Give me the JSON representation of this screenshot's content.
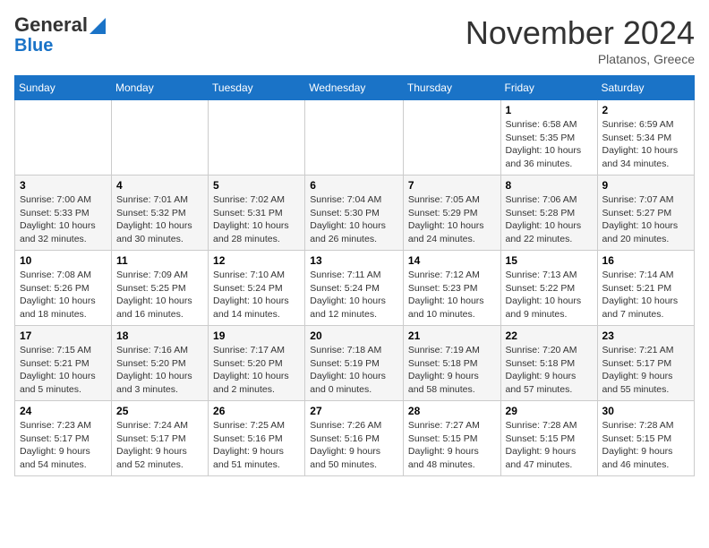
{
  "header": {
    "logo_line1": "General",
    "logo_line2": "Blue",
    "month": "November 2024",
    "location": "Platanos, Greece"
  },
  "days_of_week": [
    "Sunday",
    "Monday",
    "Tuesday",
    "Wednesday",
    "Thursday",
    "Friday",
    "Saturday"
  ],
  "weeks": [
    [
      {
        "day": "",
        "text": ""
      },
      {
        "day": "",
        "text": ""
      },
      {
        "day": "",
        "text": ""
      },
      {
        "day": "",
        "text": ""
      },
      {
        "day": "",
        "text": ""
      },
      {
        "day": "1",
        "text": "Sunrise: 6:58 AM\nSunset: 5:35 PM\nDaylight: 10 hours and 36 minutes."
      },
      {
        "day": "2",
        "text": "Sunrise: 6:59 AM\nSunset: 5:34 PM\nDaylight: 10 hours and 34 minutes."
      }
    ],
    [
      {
        "day": "3",
        "text": "Sunrise: 7:00 AM\nSunset: 5:33 PM\nDaylight: 10 hours and 32 minutes."
      },
      {
        "day": "4",
        "text": "Sunrise: 7:01 AM\nSunset: 5:32 PM\nDaylight: 10 hours and 30 minutes."
      },
      {
        "day": "5",
        "text": "Sunrise: 7:02 AM\nSunset: 5:31 PM\nDaylight: 10 hours and 28 minutes."
      },
      {
        "day": "6",
        "text": "Sunrise: 7:04 AM\nSunset: 5:30 PM\nDaylight: 10 hours and 26 minutes."
      },
      {
        "day": "7",
        "text": "Sunrise: 7:05 AM\nSunset: 5:29 PM\nDaylight: 10 hours and 24 minutes."
      },
      {
        "day": "8",
        "text": "Sunrise: 7:06 AM\nSunset: 5:28 PM\nDaylight: 10 hours and 22 minutes."
      },
      {
        "day": "9",
        "text": "Sunrise: 7:07 AM\nSunset: 5:27 PM\nDaylight: 10 hours and 20 minutes."
      }
    ],
    [
      {
        "day": "10",
        "text": "Sunrise: 7:08 AM\nSunset: 5:26 PM\nDaylight: 10 hours and 18 minutes."
      },
      {
        "day": "11",
        "text": "Sunrise: 7:09 AM\nSunset: 5:25 PM\nDaylight: 10 hours and 16 minutes."
      },
      {
        "day": "12",
        "text": "Sunrise: 7:10 AM\nSunset: 5:24 PM\nDaylight: 10 hours and 14 minutes."
      },
      {
        "day": "13",
        "text": "Sunrise: 7:11 AM\nSunset: 5:24 PM\nDaylight: 10 hours and 12 minutes."
      },
      {
        "day": "14",
        "text": "Sunrise: 7:12 AM\nSunset: 5:23 PM\nDaylight: 10 hours and 10 minutes."
      },
      {
        "day": "15",
        "text": "Sunrise: 7:13 AM\nSunset: 5:22 PM\nDaylight: 10 hours and 9 minutes."
      },
      {
        "day": "16",
        "text": "Sunrise: 7:14 AM\nSunset: 5:21 PM\nDaylight: 10 hours and 7 minutes."
      }
    ],
    [
      {
        "day": "17",
        "text": "Sunrise: 7:15 AM\nSunset: 5:21 PM\nDaylight: 10 hours and 5 minutes."
      },
      {
        "day": "18",
        "text": "Sunrise: 7:16 AM\nSunset: 5:20 PM\nDaylight: 10 hours and 3 minutes."
      },
      {
        "day": "19",
        "text": "Sunrise: 7:17 AM\nSunset: 5:20 PM\nDaylight: 10 hours and 2 minutes."
      },
      {
        "day": "20",
        "text": "Sunrise: 7:18 AM\nSunset: 5:19 PM\nDaylight: 10 hours and 0 minutes."
      },
      {
        "day": "21",
        "text": "Sunrise: 7:19 AM\nSunset: 5:18 PM\nDaylight: 9 hours and 58 minutes."
      },
      {
        "day": "22",
        "text": "Sunrise: 7:20 AM\nSunset: 5:18 PM\nDaylight: 9 hours and 57 minutes."
      },
      {
        "day": "23",
        "text": "Sunrise: 7:21 AM\nSunset: 5:17 PM\nDaylight: 9 hours and 55 minutes."
      }
    ],
    [
      {
        "day": "24",
        "text": "Sunrise: 7:23 AM\nSunset: 5:17 PM\nDaylight: 9 hours and 54 minutes."
      },
      {
        "day": "25",
        "text": "Sunrise: 7:24 AM\nSunset: 5:17 PM\nDaylight: 9 hours and 52 minutes."
      },
      {
        "day": "26",
        "text": "Sunrise: 7:25 AM\nSunset: 5:16 PM\nDaylight: 9 hours and 51 minutes."
      },
      {
        "day": "27",
        "text": "Sunrise: 7:26 AM\nSunset: 5:16 PM\nDaylight: 9 hours and 50 minutes."
      },
      {
        "day": "28",
        "text": "Sunrise: 7:27 AM\nSunset: 5:15 PM\nDaylight: 9 hours and 48 minutes."
      },
      {
        "day": "29",
        "text": "Sunrise: 7:28 AM\nSunset: 5:15 PM\nDaylight: 9 hours and 47 minutes."
      },
      {
        "day": "30",
        "text": "Sunrise: 7:28 AM\nSunset: 5:15 PM\nDaylight: 9 hours and 46 minutes."
      }
    ]
  ]
}
